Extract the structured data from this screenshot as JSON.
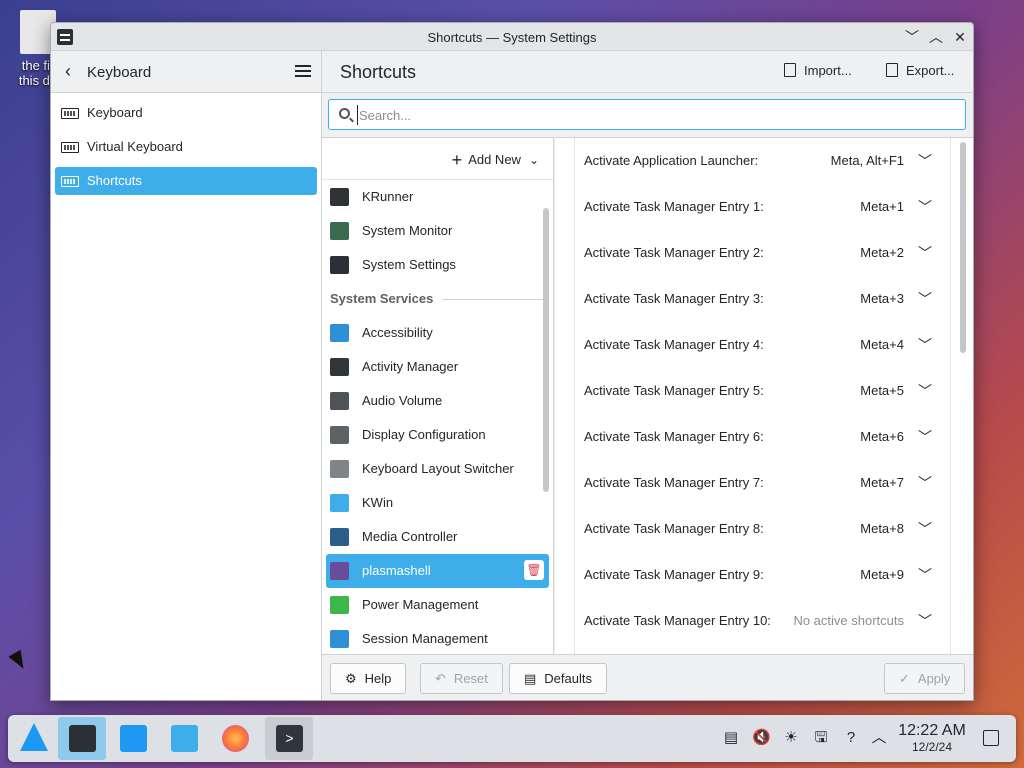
{
  "desktop": {
    "icon_label_line1": "the fir",
    "icon_label_line2": "this de"
  },
  "window": {
    "title": "Shortcuts — System Settings",
    "controls": [
      "minimize",
      "maximize",
      "close"
    ]
  },
  "sidebar": {
    "header": "Keyboard",
    "items": [
      {
        "label": "Keyboard",
        "icon": "keyboard-icon"
      },
      {
        "label": "Virtual Keyboard",
        "icon": "keyboard-icon"
      },
      {
        "label": "Shortcuts",
        "icon": "keyboard-icon",
        "active": true
      }
    ]
  },
  "main": {
    "title": "Shortcuts",
    "import_label": "Import...",
    "export_label": "Export...",
    "search_placeholder": "Search..."
  },
  "list": {
    "add_new_label": "Add New",
    "apps": [
      {
        "label": "KRunner",
        "color": "#2f3338"
      },
      {
        "label": "System Monitor",
        "color": "#3a6b4f"
      },
      {
        "label": "System Settings",
        "color": "#2b3036"
      }
    ],
    "section_label": "System Services",
    "services": [
      {
        "label": "Accessibility",
        "color": "#2f8fd8"
      },
      {
        "label": "Activity Manager",
        "color": "#31363b"
      },
      {
        "label": "Audio Volume",
        "color": "#4d5358"
      },
      {
        "label": "Display Configuration",
        "color": "#5d6266"
      },
      {
        "label": "Keyboard Layout Switcher",
        "color": "#7f8589"
      },
      {
        "label": "KWin",
        "color": "#3daee9"
      },
      {
        "label": "Media Controller",
        "color": "#2b5f8a"
      },
      {
        "label": "plasmashell",
        "color": "#6b4c9a",
        "selected": true
      },
      {
        "label": "Power Management",
        "color": "#3cb84b"
      },
      {
        "label": "Session Management",
        "color": "#2f8fd8"
      }
    ]
  },
  "shortcuts": [
    {
      "action": "Activate Application Launcher:",
      "keys": "Meta, Alt+F1"
    },
    {
      "action": "Activate Task Manager Entry 1:",
      "keys": "Meta+1"
    },
    {
      "action": "Activate Task Manager Entry 2:",
      "keys": "Meta+2"
    },
    {
      "action": "Activate Task Manager Entry 3:",
      "keys": "Meta+3"
    },
    {
      "action": "Activate Task Manager Entry 4:",
      "keys": "Meta+4"
    },
    {
      "action": "Activate Task Manager Entry 5:",
      "keys": "Meta+5"
    },
    {
      "action": "Activate Task Manager Entry 6:",
      "keys": "Meta+6"
    },
    {
      "action": "Activate Task Manager Entry 7:",
      "keys": "Meta+7"
    },
    {
      "action": "Activate Task Manager Entry 8:",
      "keys": "Meta+8"
    },
    {
      "action": "Activate Task Manager Entry 9:",
      "keys": "Meta+9"
    },
    {
      "action": "Activate Task Manager Entry 10:",
      "keys": "No active shortcuts"
    }
  ],
  "bottom": {
    "help_label": "Help",
    "reset_label": "Reset",
    "defaults_label": "Defaults",
    "apply_label": "Apply"
  },
  "taskbar": {
    "time": "12:22 AM",
    "date": "12/2/24",
    "accent": "#3daee9"
  }
}
